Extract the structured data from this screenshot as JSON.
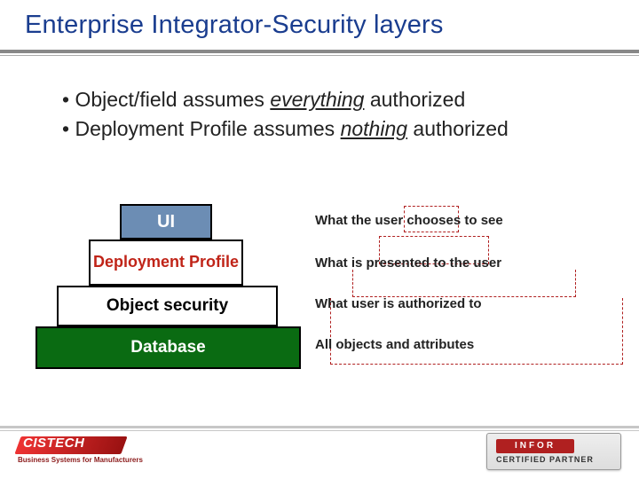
{
  "title": "Enterprise Integrator-Security layers",
  "bullets": {
    "b1_pre": "Object/field assumes ",
    "b1_em": "everything",
    "b1_post": " authorized",
    "b2_pre": "Deployment Profile assumes ",
    "b2_em": "nothing",
    "b2_post": " authorized"
  },
  "layers": {
    "ui": "UI",
    "dp": "Deployment Profile",
    "os": "Object security",
    "db": "Database"
  },
  "descs": {
    "d1": "What the user chooses to  see",
    "d2": "What is presented to the user",
    "d3": "What user is authorized to",
    "d4": "All objects and attributes"
  },
  "logos": {
    "left_name": "CISTECH",
    "left_tag": "Business Systems for Manufacturers",
    "right_name": "INFOR",
    "right_tag": "CERTIFIED PARTNER"
  }
}
